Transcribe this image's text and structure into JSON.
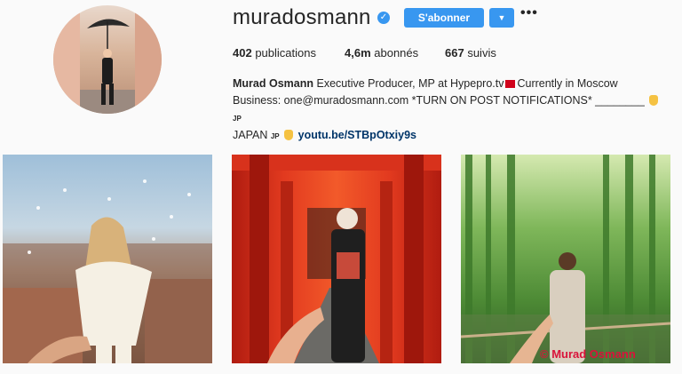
{
  "profile": {
    "username": "muradosmann",
    "verified_icon": "verified-badge-icon",
    "subscribe_label": "S'abonner",
    "dropdown_icon": "chevron-down-icon",
    "more_label": "•••",
    "stats": {
      "posts_count": "402",
      "posts_label": "publications",
      "followers_count": "4,6m",
      "followers_label": "abonnés",
      "following_count": "667",
      "following_label": "suivis"
    },
    "bio": {
      "name": "Murad Osmann",
      "line1": "Executive Producer, MP at Hypepro.tv",
      "line1b": "Currently in Moscow",
      "line2": "Business: one@muradosmann.com *TURN ON POST NOTIFICATIONS* ________",
      "jp1": "JP",
      "line3": "JAPAN",
      "jp2": "JP",
      "link": "youtu.be/STBpOtxiy9s"
    },
    "accent_color": "#3897f0"
  },
  "posts": [
    {
      "icon": "city-rooftop-photo"
    },
    {
      "icon": "torii-gates-photo"
    },
    {
      "icon": "bamboo-forest-photo"
    }
  ],
  "watermark": "©   Murad Osmann"
}
